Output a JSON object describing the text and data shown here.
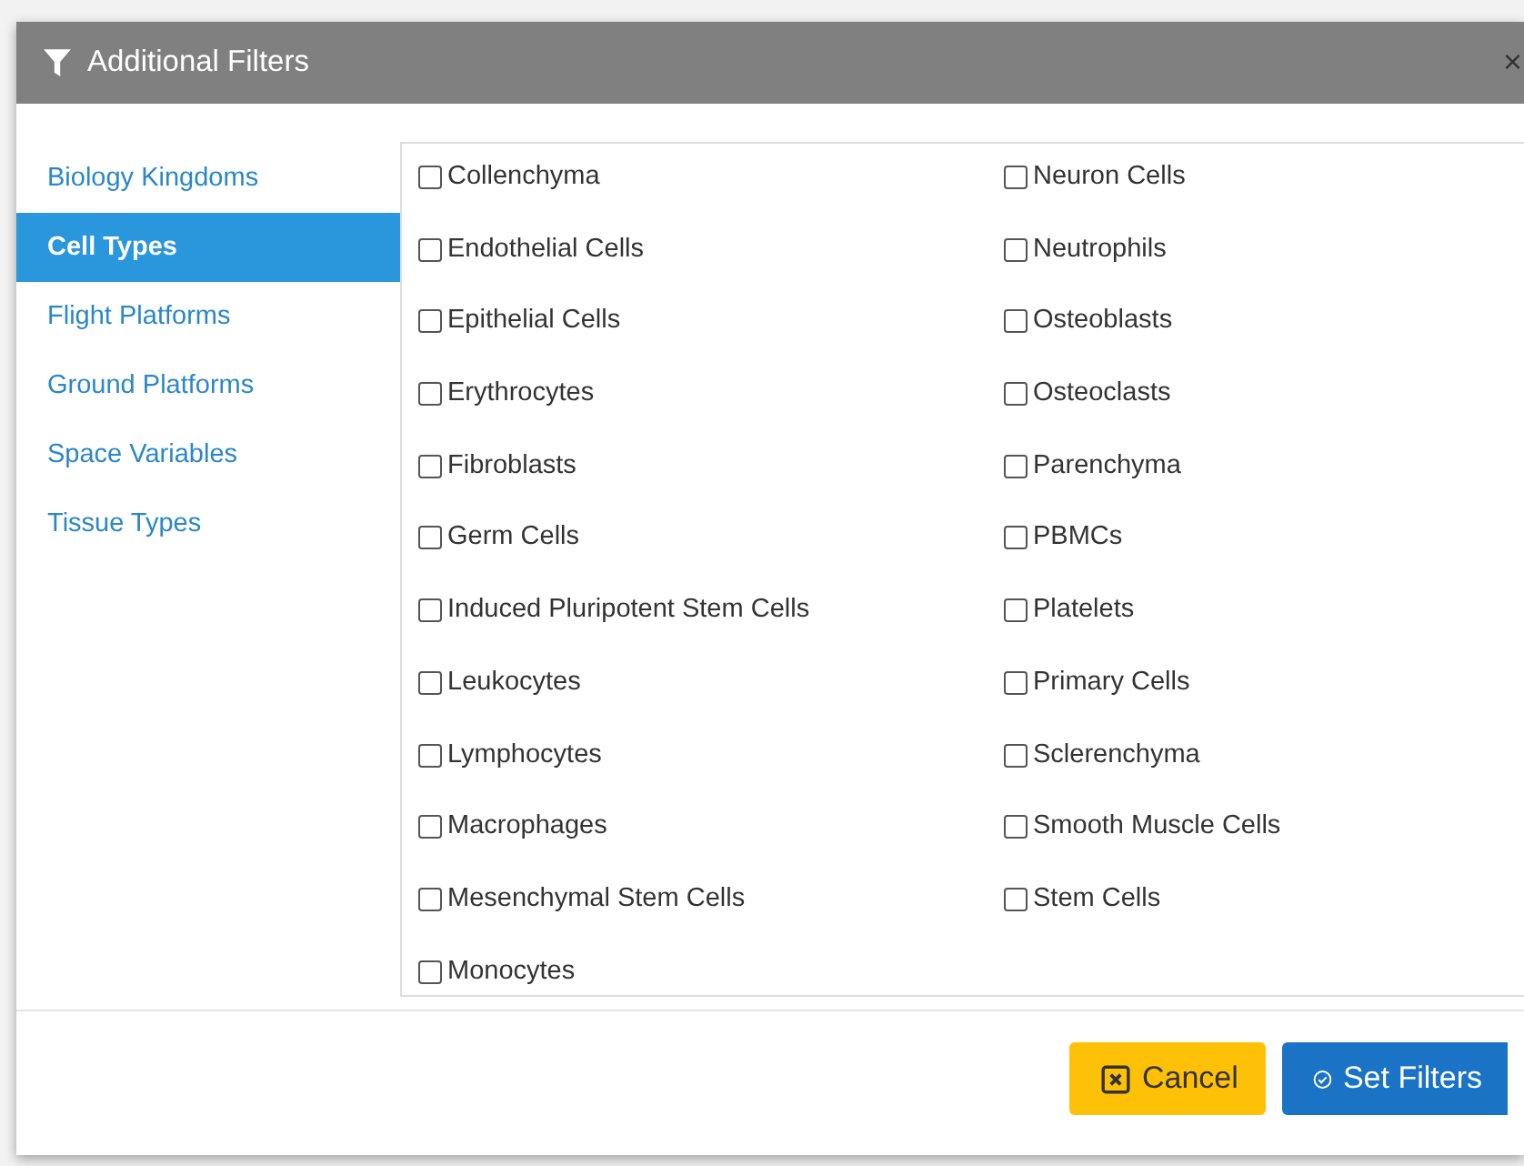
{
  "dialog": {
    "title": "Additional Filters",
    "close": "×"
  },
  "categories": [
    {
      "label": "Biology Kingdoms",
      "selected": false
    },
    {
      "label": "Cell Types",
      "selected": true
    },
    {
      "label": "Flight Platforms",
      "selected": false
    },
    {
      "label": "Ground Platforms",
      "selected": false
    },
    {
      "label": "Space Variables",
      "selected": false
    },
    {
      "label": "Tissue Types",
      "selected": false
    }
  ],
  "options": [
    {
      "label": "Collenchyma",
      "checked": false
    },
    {
      "label": "Endothelial Cells",
      "checked": false
    },
    {
      "label": "Epithelial Cells",
      "checked": false
    },
    {
      "label": "Erythrocytes",
      "checked": false
    },
    {
      "label": "Fibroblasts",
      "checked": false
    },
    {
      "label": "Germ Cells",
      "checked": false
    },
    {
      "label": "Induced Pluripotent Stem Cells",
      "checked": false
    },
    {
      "label": "Leukocytes",
      "checked": false
    },
    {
      "label": "Lymphocytes",
      "checked": false
    },
    {
      "label": "Macrophages",
      "checked": false
    },
    {
      "label": "Mesenchymal Stem Cells",
      "checked": false
    },
    {
      "label": "Monocytes",
      "checked": false
    },
    {
      "label": "Neuron Cells",
      "checked": false
    },
    {
      "label": "Neutrophils",
      "checked": false
    },
    {
      "label": "Osteoblasts",
      "checked": false
    },
    {
      "label": "Osteoclasts",
      "checked": false
    },
    {
      "label": "Parenchyma",
      "checked": false
    },
    {
      "label": "PBMCs",
      "checked": false
    },
    {
      "label": "Platelets",
      "checked": false
    },
    {
      "label": "Primary Cells",
      "checked": false
    },
    {
      "label": "Sclerenchyma",
      "checked": false
    },
    {
      "label": "Smooth Muscle Cells",
      "checked": false
    },
    {
      "label": "Stem Cells",
      "checked": false
    }
  ],
  "buttons": [
    {
      "label": "Cancel",
      "kind": "cancel"
    },
    {
      "label": "Set Filters",
      "kind": "confirm"
    }
  ]
}
